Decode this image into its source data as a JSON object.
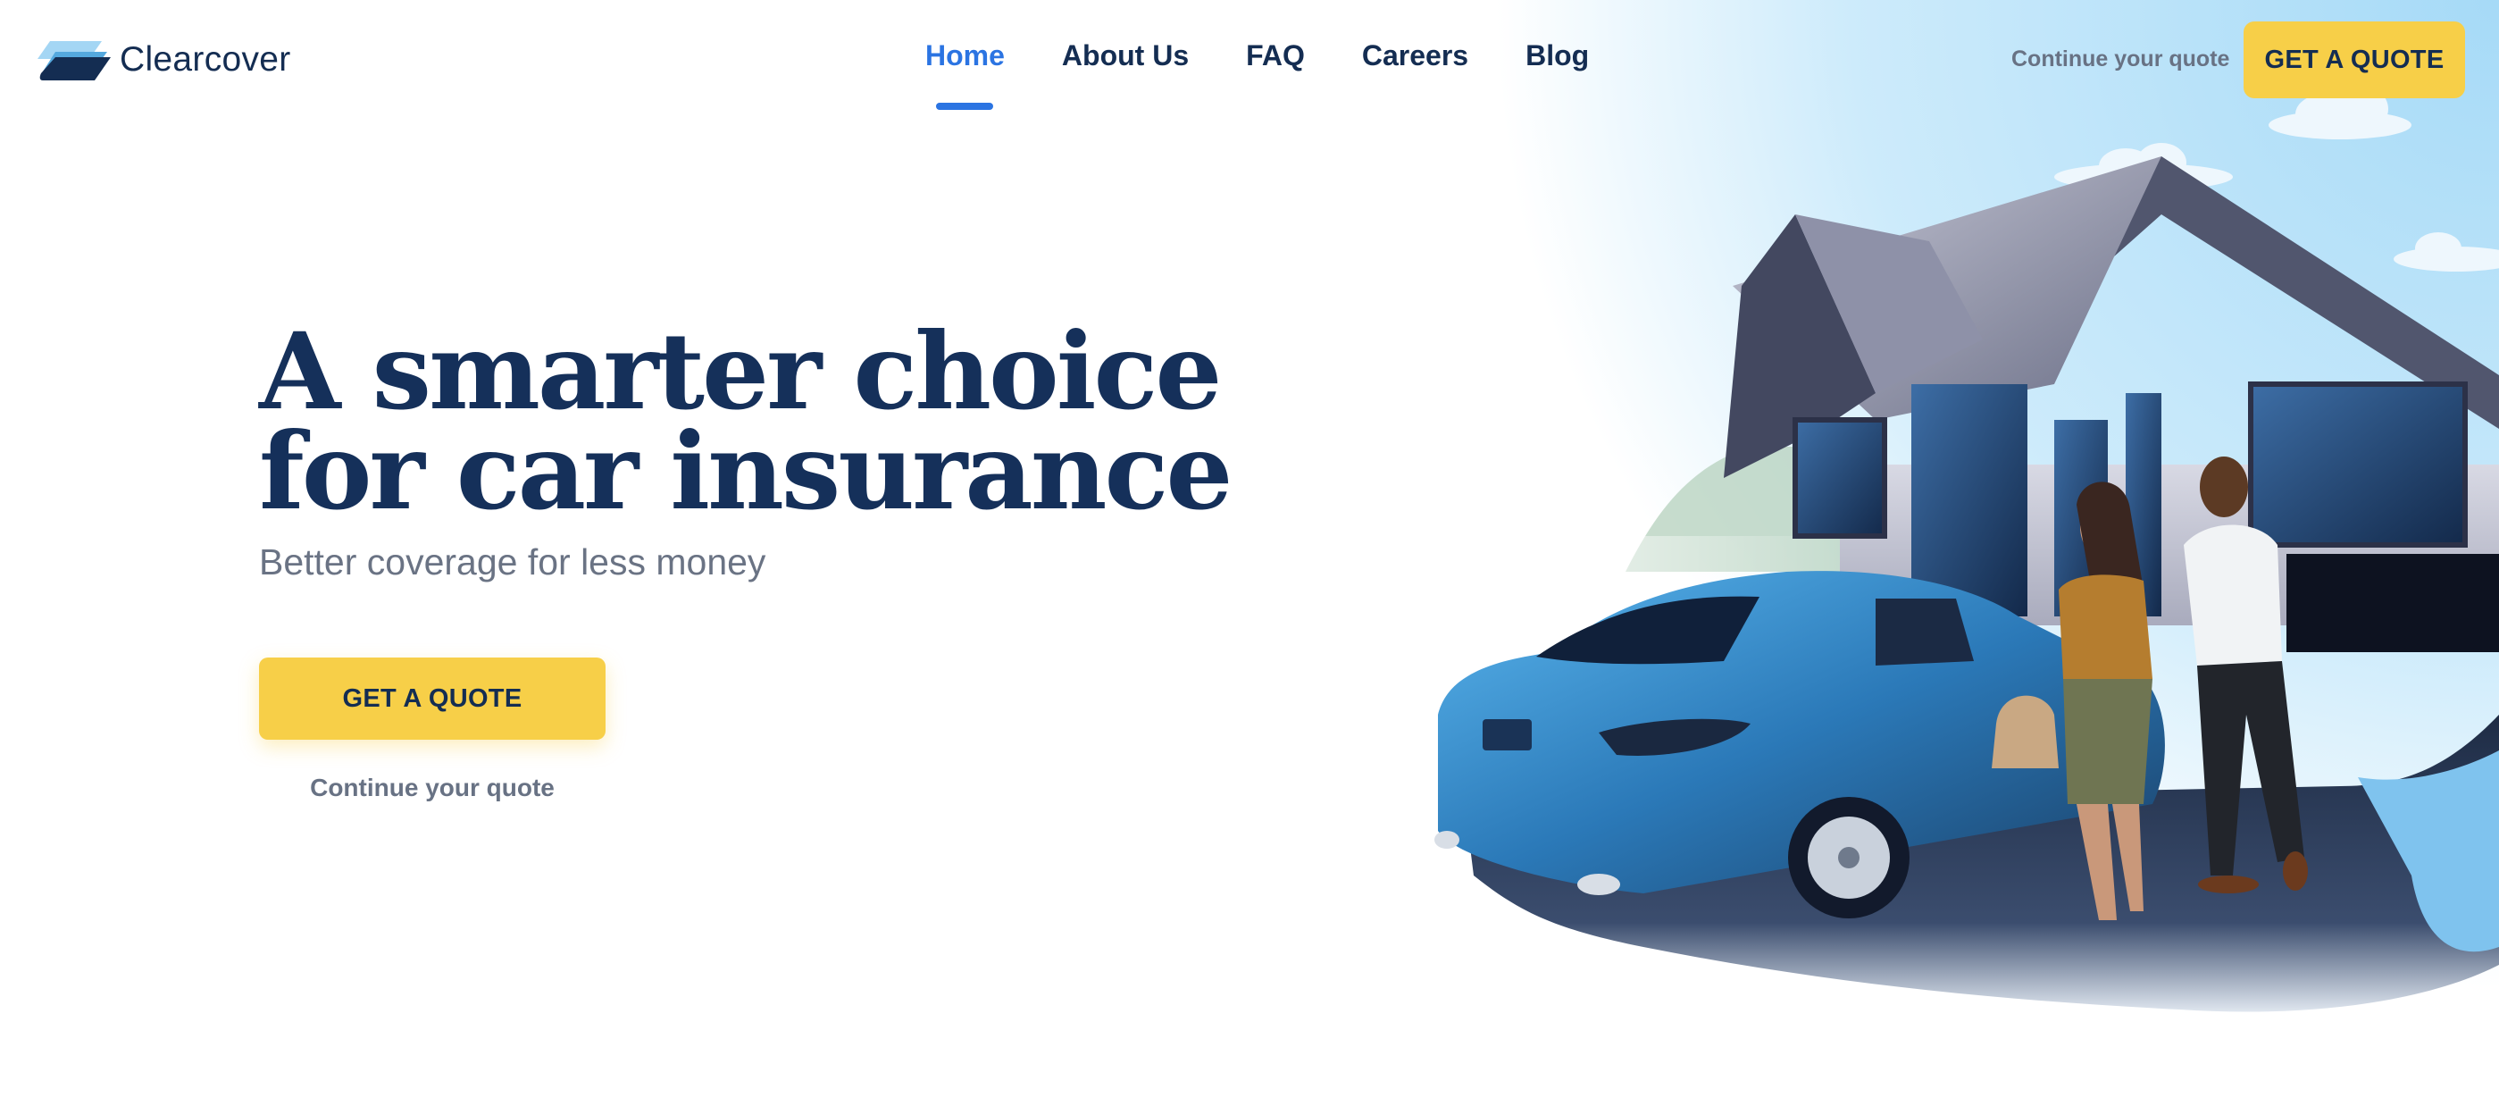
{
  "brand": {
    "name": "Clearcover",
    "logo_icon": "clearcover-logo-icon"
  },
  "nav": {
    "items": [
      {
        "label": "Home",
        "active": true
      },
      {
        "label": "About Us",
        "active": false
      },
      {
        "label": "FAQ",
        "active": false
      },
      {
        "label": "Careers",
        "active": false
      },
      {
        "label": "Blog",
        "active": false
      }
    ]
  },
  "header_actions": {
    "continue_label": "Continue your quote",
    "cta_label": "GET A QUOTE"
  },
  "hero": {
    "title_line1": "A smarter choice",
    "title_line2": "for car insurance",
    "subtitle": "Better coverage for less money",
    "cta_label": "GET A QUOTE",
    "continue_label": "Continue your quote"
  },
  "illustration": {
    "description": "Couple standing beside a blue sedan in front of a gray house under a light blue sky"
  },
  "colors": {
    "navy": "#142d52",
    "accent_blue": "#2b74e2",
    "cta_yellow": "#f7cf48",
    "muted_gray": "#687284"
  }
}
